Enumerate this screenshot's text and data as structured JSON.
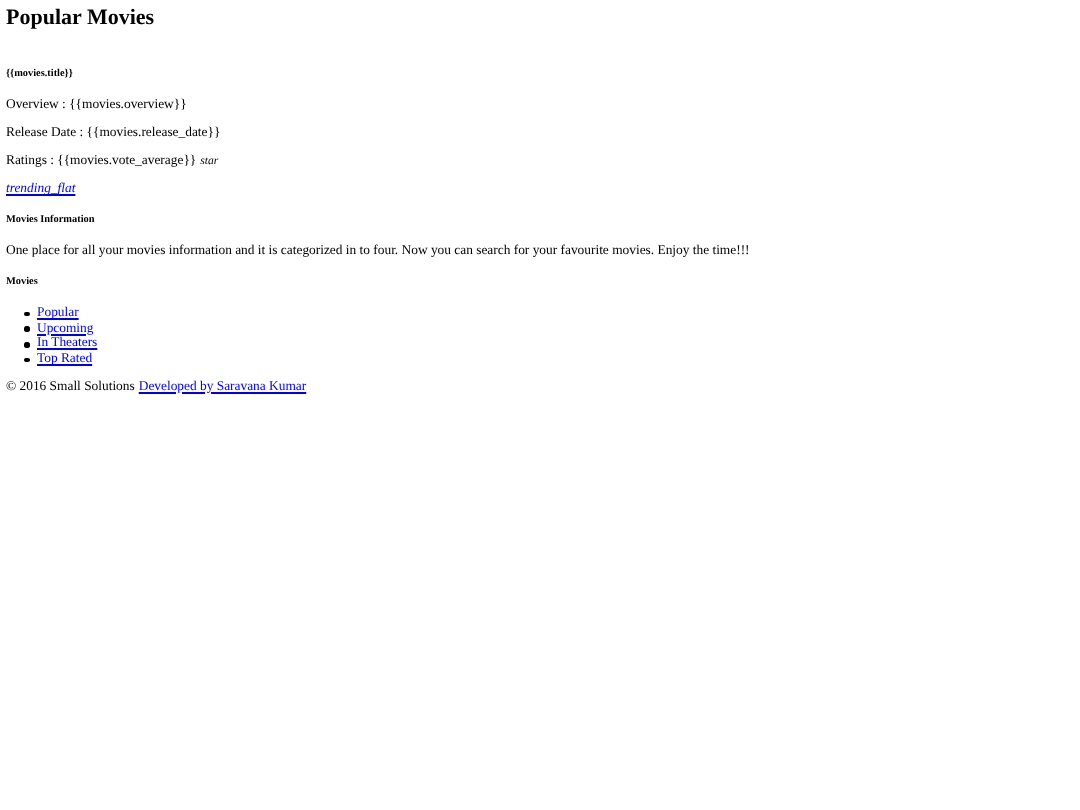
{
  "header": {
    "title": "Popular Movies"
  },
  "movie": {
    "title": "{{movies.title}}",
    "overview": "Overview : {{movies.overview}}",
    "release_date": "Release Date : {{movies.release_date}}",
    "ratings": "Ratings : {{movies.vote_average}}",
    "ratings_icon": "star",
    "link": "trending_flat"
  },
  "info": {
    "heading": "Movies Information",
    "text": "One place for all your movies information and it is categorized in to four. Now you can search for your favourite movies. Enjoy the time!!!"
  },
  "nav": {
    "heading": "Movies",
    "items": [
      "Popular",
      "Upcoming",
      "In Theaters",
      "Top Rated"
    ]
  },
  "footer": {
    "copyright": "© 2016 Small Solutions",
    "link": "Developed by Saravana Kumar"
  }
}
